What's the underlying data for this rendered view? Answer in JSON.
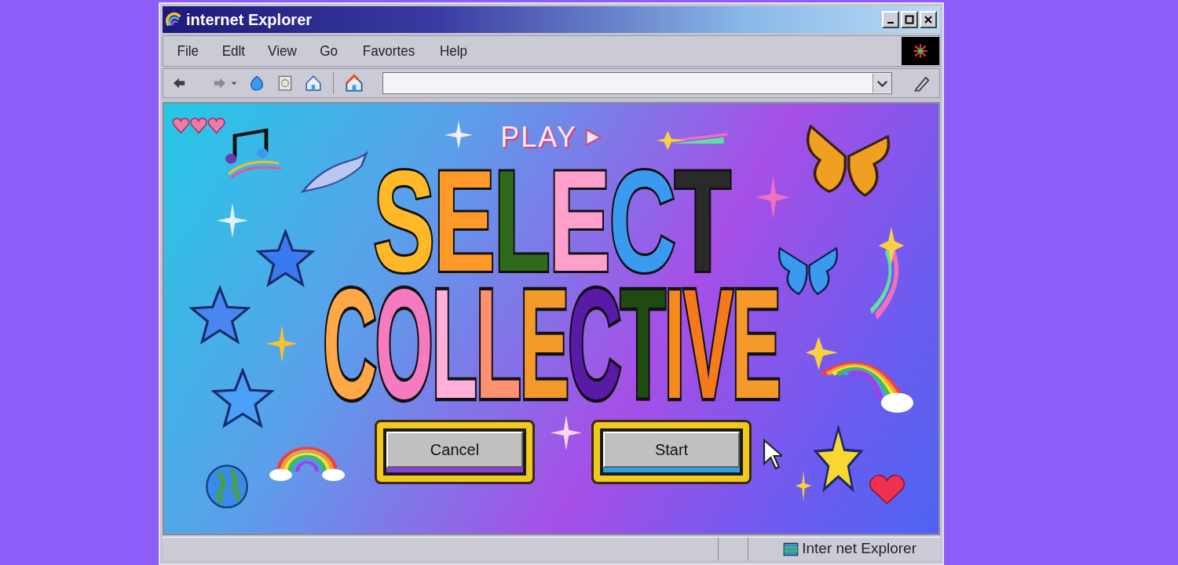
{
  "window": {
    "title": "internet Explorer"
  },
  "menu": [
    "File",
    "Edlt",
    "View",
    "Go",
    "Favortes",
    "Help"
  ],
  "page": {
    "play": "PLAY",
    "title_lines": [
      "SELECT",
      "COLLECTIVE"
    ],
    "buttons": [
      {
        "label": "Cancel",
        "color": "#8a3fd8"
      },
      {
        "label": "Start",
        "color": "#2aa0e8"
      }
    ]
  },
  "status_bar": {
    "text": "Inter net Explorer"
  }
}
